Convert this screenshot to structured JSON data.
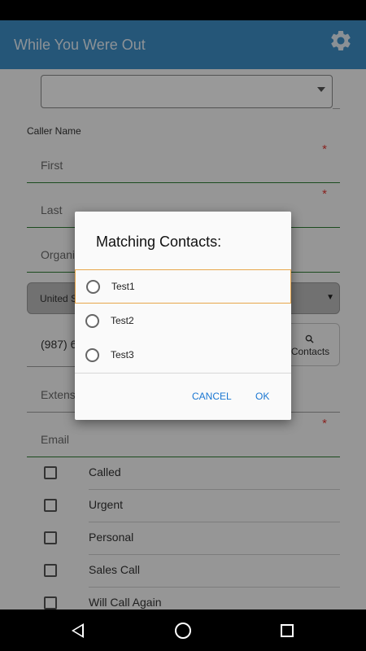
{
  "app_bar": {
    "title": "While You Were Out",
    "settings_icon": "gear-icon"
  },
  "form": {
    "caller_name_label": "Caller Name",
    "first_placeholder": "First",
    "last_placeholder": "Last",
    "organization_placeholder": "Organi",
    "country_value": "United S",
    "phone_value": "(987) 6",
    "contacts_button": {
      "icon": "search-icon",
      "label": "Contacts"
    },
    "extension_placeholder": "Extens",
    "email_placeholder": "Email",
    "required_marker": "*",
    "country_arrow": "▼",
    "checkboxes": [
      {
        "label": "Called",
        "checked": false
      },
      {
        "label": "Urgent",
        "checked": false
      },
      {
        "label": "Personal",
        "checked": false
      },
      {
        "label": "Sales Call",
        "checked": false
      },
      {
        "label": "Will Call Again",
        "checked": false
      }
    ]
  },
  "dialog": {
    "title": "Matching Contacts:",
    "options": [
      {
        "label": "Test1",
        "selected": true
      },
      {
        "label": "Test2",
        "selected": false
      },
      {
        "label": "Test3",
        "selected": false
      }
    ],
    "cancel_label": "CANCEL",
    "ok_label": "OK"
  },
  "colors": {
    "app_bar": "#3f8fc9",
    "accent_blue": "#1976d2",
    "field_line_green": "#2e7d32",
    "required_red": "#e53935",
    "selected_option_border": "#e8a64c"
  },
  "nav_bar": {
    "icons": [
      "back-icon",
      "home-icon",
      "recents-icon"
    ]
  }
}
